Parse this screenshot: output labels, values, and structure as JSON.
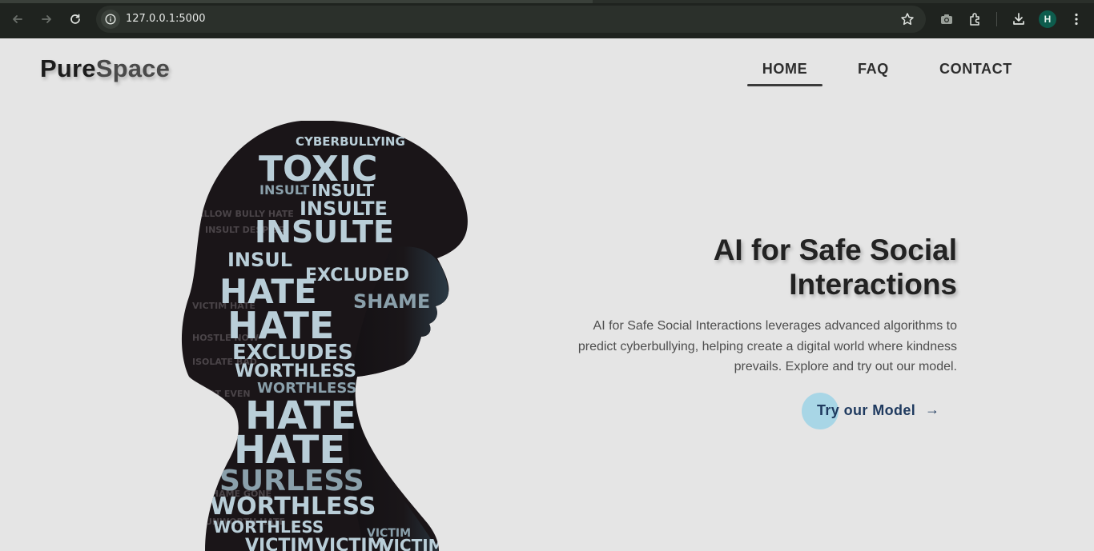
{
  "browser": {
    "url": "127.0.0.1:5000",
    "profile_initial": "H",
    "icons": [
      "back-icon",
      "forward-icon",
      "reload-icon",
      "site-info-icon",
      "bookmark-star-icon",
      "screenshot-icon",
      "extensions-icon",
      "download-icon",
      "more-menu-icon"
    ]
  },
  "header": {
    "logo_part1": "Pure",
    "logo_part2": "Space",
    "nav": {
      "home": "HOME",
      "faq": "FAQ",
      "contact": "CONTACT"
    }
  },
  "hero": {
    "title_line1": "AI for Safe Social",
    "title_line2": "Interactions",
    "description": "AI for Safe Social Interactions leverages advanced algorithms to predict cyberbullying, helping create a digital world where kindness prevails. Explore and try out our model.",
    "cta_label": "Try our Model",
    "cta_arrow": "→",
    "image_words": {
      "w1": "CYBERBULLYING",
      "w2": "TOXIC",
      "w3": "INSULT",
      "w4": "INSULT",
      "w5": "INSULTE",
      "w6": "INSULTE",
      "w7": "INSUL",
      "w8": "EXCLUDED",
      "w9": "HATE",
      "w10": "SHAME",
      "w11": "HATE",
      "w12": "EXCLUDES",
      "w13": "WORTHLESS",
      "w14": "WORTHLESS",
      "w15": "HATE",
      "w16": "HATE",
      "w17": "SURLESS",
      "w18": "WORTHLESS",
      "w19": "WORTHLESS",
      "w20": "VICTIM",
      "w21": "VICTIM",
      "w22": "VICTIM",
      "w23": "VICTIM"
    }
  },
  "colors": {
    "page_bg": "#e5e5e5",
    "chrome_bg": "#1f231f",
    "cta_blob": "#a8d6e6",
    "cta_text": "#1f3a5f",
    "avatar_bg": "#0d5c4d"
  }
}
